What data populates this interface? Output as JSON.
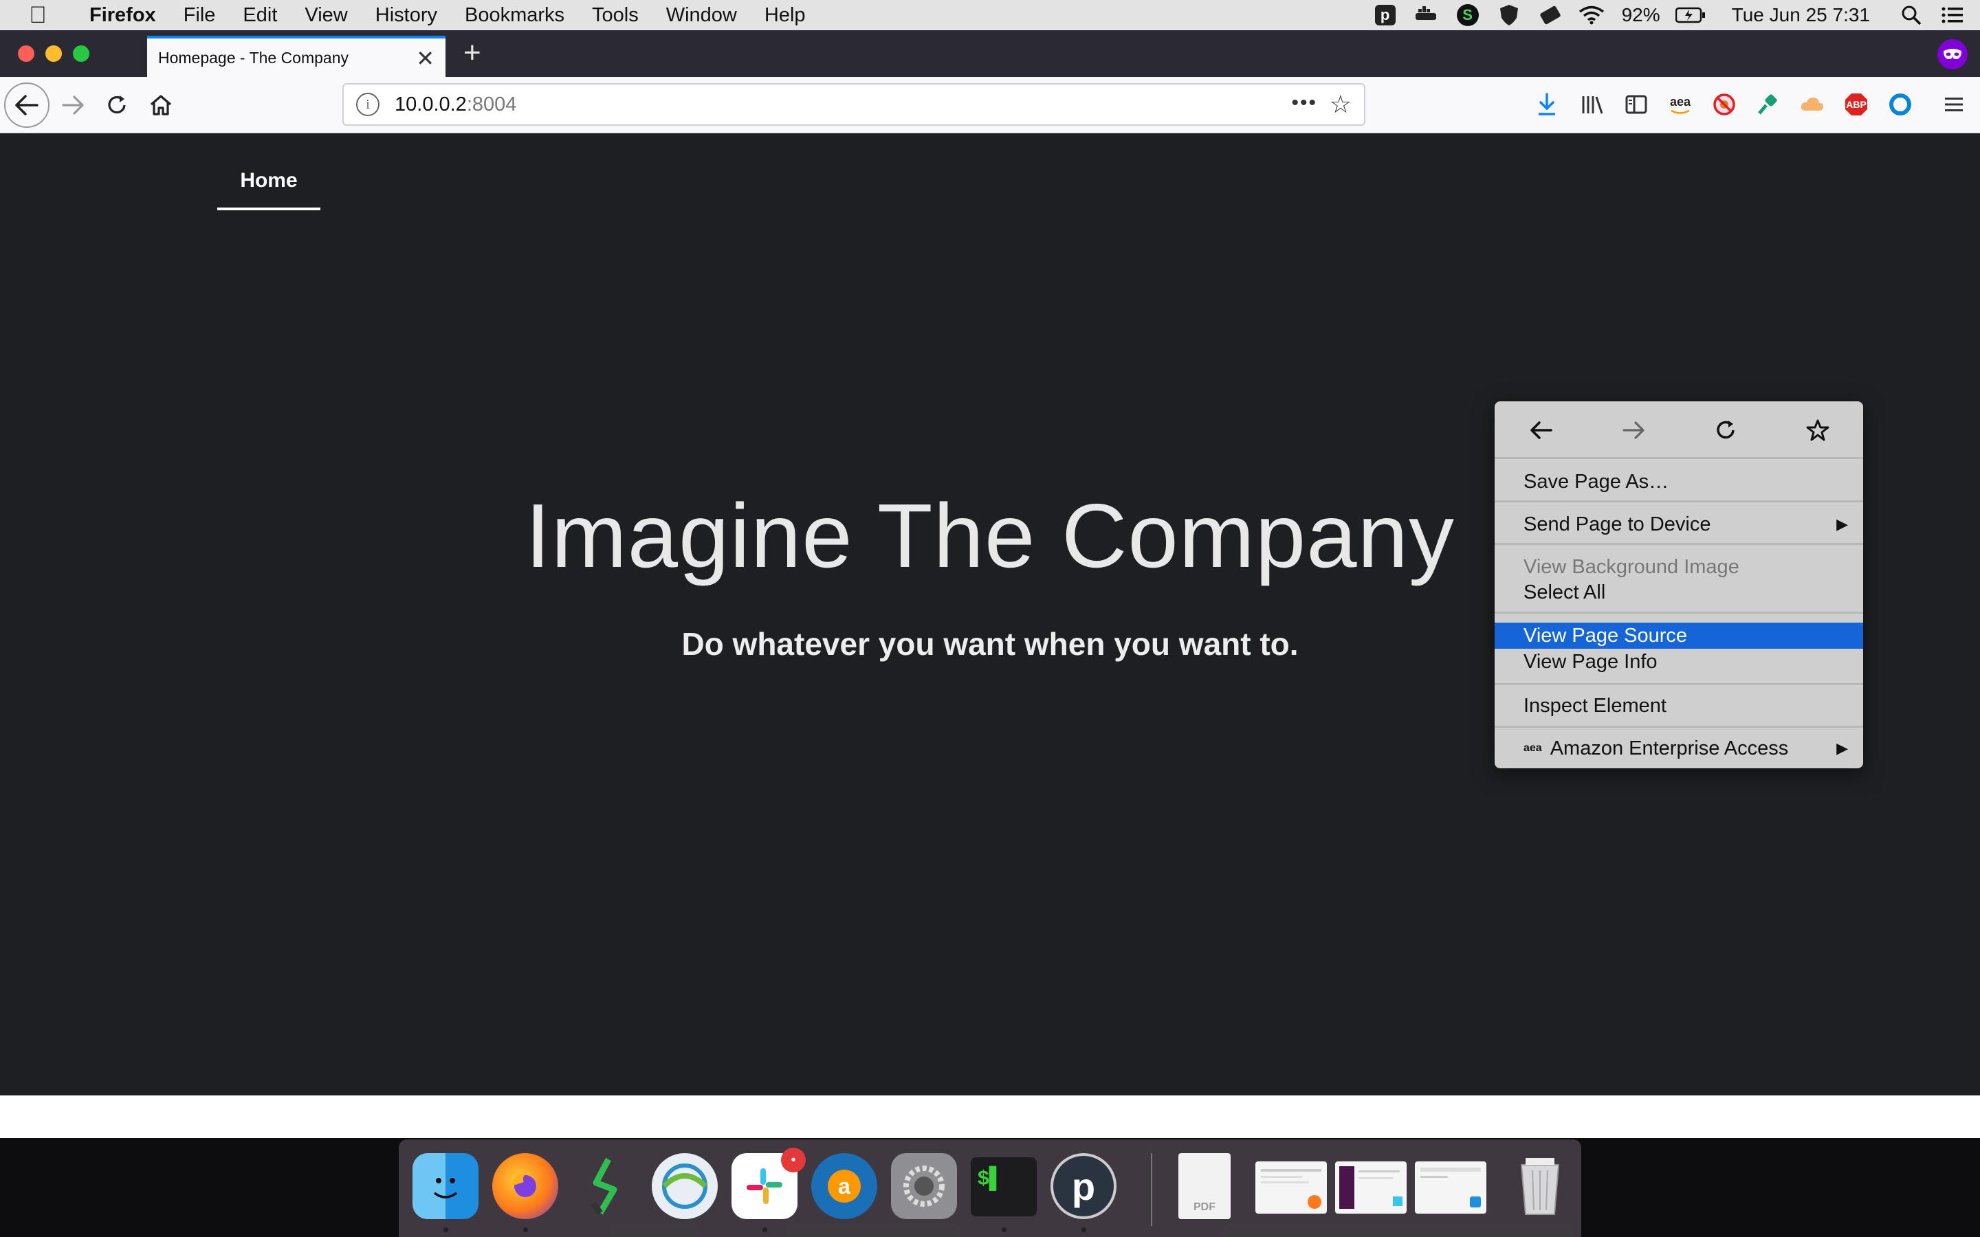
{
  "menubar": {
    "app_name": "Firefox",
    "items": [
      "File",
      "Edit",
      "View",
      "History",
      "Bookmarks",
      "Tools",
      "Window",
      "Help"
    ],
    "battery": "92%",
    "clock": "Tue Jun 25  7:31"
  },
  "tabs": [
    {
      "title": "Homepage - The Company",
      "active": true
    }
  ],
  "navbar": {
    "url_host": "10.0.0.2",
    "url_port": ":8004",
    "dots": "•••",
    "aea_label": "aea",
    "abp_label": "ABP"
  },
  "page": {
    "nav_home": "Home",
    "hero_title": "Imagine The Company",
    "hero_subtitle": "Do whatever you want when you want to."
  },
  "context_menu": {
    "save_page_as": "Save Page As…",
    "send_page_to_device": "Send Page to Device",
    "view_background_image": "View Background Image",
    "select_all": "Select All",
    "view_page_source": "View Page Source",
    "view_page_info": "View Page Info",
    "inspect_element": "Inspect Element",
    "amazon_enterprise_access": "Amazon Enterprise Access",
    "aea_icon_text": "aea",
    "highlighted": "View Page Source"
  },
  "dock": {
    "slack_badge": "•",
    "terminal_glyph": "$▌",
    "plex_glyph": "p",
    "pdf_label": "PDF"
  },
  "colors": {
    "page_bg": "#1e1f22",
    "highlight": "#1565d8",
    "tab_accent": "#0a84ff"
  }
}
